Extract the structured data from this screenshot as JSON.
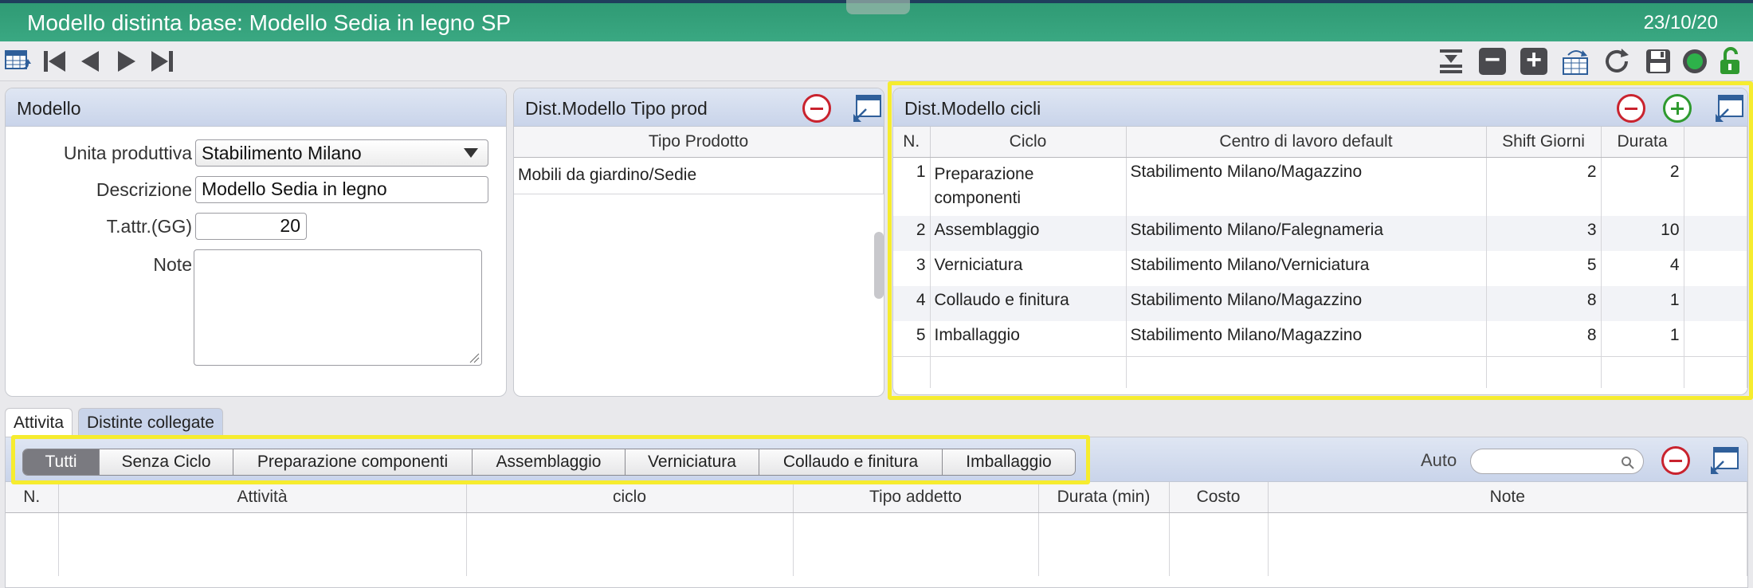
{
  "window": {
    "title": "Modello distinta base: Modello Sedia in legno SP",
    "date": "23/10/20"
  },
  "modello": {
    "title": "Modello",
    "unita_label": "Unita produttiva",
    "unita_value": "Stabilimento Milano",
    "descrizione_label": "Descrizione",
    "descrizione_value": "Modello Sedia in legno",
    "tattr_label": "T.attr.(GG)",
    "tattr_value": "20",
    "note_label": "Note"
  },
  "tipo_prod": {
    "title": "Dist.Modello Tipo prod",
    "column": "Tipo Prodotto",
    "rows": [
      "Mobili da giardino/Sedie"
    ]
  },
  "cicli": {
    "title": "Dist.Modello cicli",
    "columns": [
      "N.",
      "Ciclo",
      "Centro di lavoro default",
      "Shift Giorni",
      "Durata"
    ],
    "rows": [
      {
        "n": "1",
        "ciclo": "Preparazione componenti",
        "centro": "Stabilimento Milano/Magazzino",
        "shift": "2",
        "durata": "2"
      },
      {
        "n": "2",
        "ciclo": "Assemblaggio",
        "centro": "Stabilimento Milano/Falegnameria",
        "shift": "3",
        "durata": "10"
      },
      {
        "n": "3",
        "ciclo": "Verniciatura",
        "centro": "Stabilimento Milano/Verniciatura",
        "shift": "5",
        "durata": "4"
      },
      {
        "n": "4",
        "ciclo": "Collaudo e finitura",
        "centro": "Stabilimento Milano/Magazzino",
        "shift": "8",
        "durata": "1"
      },
      {
        "n": "5",
        "ciclo": "Imballaggio",
        "centro": "Stabilimento Milano/Magazzino",
        "shift": "8",
        "durata": "1"
      }
    ]
  },
  "tabs": [
    "Attivita",
    "Distinte collegate"
  ],
  "filters": [
    "Tutti",
    "Senza Ciclo",
    "Preparazione componenti",
    "Assemblaggio",
    "Verniciatura",
    "Collaudo e finitura",
    "Imballaggio"
  ],
  "attivita": {
    "auto_label": "Auto",
    "search_placeholder": "",
    "columns": [
      "N.",
      "Attività",
      "ciclo",
      "Tipo addetto",
      "Durata (min)",
      "Costo",
      "Note"
    ]
  },
  "colors": {
    "title_bar": "#3aa882",
    "highlight": "#f6ec2f",
    "remove": "#c9232e",
    "add": "#2f9a2f"
  }
}
